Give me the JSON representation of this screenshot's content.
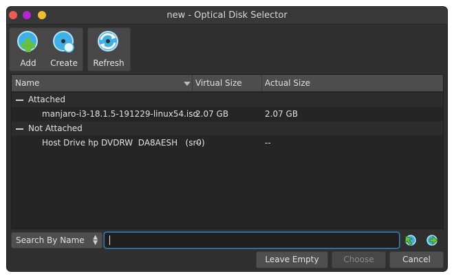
{
  "window": {
    "title": "new - Optical Disk Selector"
  },
  "toolbar": {
    "add_label": "Add",
    "create_label": "Create",
    "refresh_label": "Refresh"
  },
  "table": {
    "columns": [
      "Name",
      "Virtual Size",
      "Actual Size"
    ],
    "groups": [
      {
        "label": "Attached",
        "items": [
          {
            "name": "manjaro-i3-18.1.5-191229-linux54.iso",
            "virtual_size": "2.07 GB",
            "actual_size": "2.07 GB"
          }
        ]
      },
      {
        "label": "Not Attached",
        "items": [
          {
            "name": "Host Drive hp DVDRW  DA8AESH   (sr0)",
            "virtual_size": "--",
            "actual_size": "--"
          }
        ]
      }
    ]
  },
  "search": {
    "mode": "Search By Name",
    "value": ""
  },
  "buttons": {
    "leave_empty": "Leave Empty",
    "choose": "Choose",
    "cancel": "Cancel"
  },
  "colors": {
    "window_bg": "#2f2f2f",
    "header_bg": "#4d4d4d",
    "accent_focus": "#3f78a8",
    "icon_blue": "#3fb0e6",
    "icon_green": "#66c23a"
  }
}
